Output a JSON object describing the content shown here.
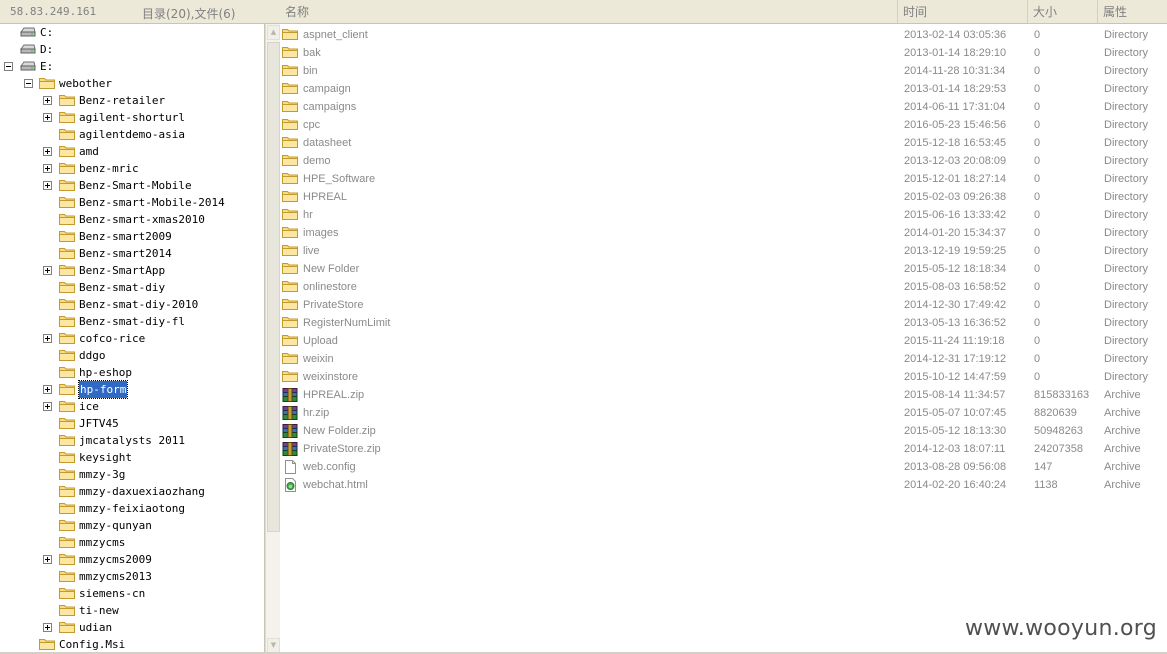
{
  "header": {
    "host_ip": "58.83.249.161",
    "dir_count": "目录(20),文件(6)"
  },
  "columns": {
    "name": "名称",
    "time": "时间",
    "size": "大小",
    "attr": "属性"
  },
  "tree": [
    {
      "label": "C:",
      "depth": 0,
      "kind": "drive",
      "expander": "none"
    },
    {
      "label": "D:",
      "depth": 0,
      "kind": "drive",
      "expander": "none"
    },
    {
      "label": "E:",
      "depth": 0,
      "kind": "drive",
      "expander": "minus"
    },
    {
      "label": "webother",
      "depth": 1,
      "kind": "folder",
      "expander": "minus"
    },
    {
      "label": "Benz-retailer",
      "depth": 2,
      "kind": "folder",
      "expander": "plus"
    },
    {
      "label": "agilent-shorturl",
      "depth": 2,
      "kind": "folder",
      "expander": "plus"
    },
    {
      "label": "agilentdemo-asia",
      "depth": 2,
      "kind": "folder",
      "expander": "none"
    },
    {
      "label": "amd",
      "depth": 2,
      "kind": "folder",
      "expander": "plus"
    },
    {
      "label": "benz-mric",
      "depth": 2,
      "kind": "folder",
      "expander": "plus"
    },
    {
      "label": "Benz-Smart-Mobile",
      "depth": 2,
      "kind": "folder",
      "expander": "plus"
    },
    {
      "label": "Benz-smart-Mobile-2014",
      "depth": 2,
      "kind": "folder",
      "expander": "none"
    },
    {
      "label": "Benz-smart-xmas2010",
      "depth": 2,
      "kind": "folder",
      "expander": "none"
    },
    {
      "label": "Benz-smart2009",
      "depth": 2,
      "kind": "folder",
      "expander": "none"
    },
    {
      "label": "Benz-smart2014",
      "depth": 2,
      "kind": "folder",
      "expander": "none"
    },
    {
      "label": "Benz-SmartApp",
      "depth": 2,
      "kind": "folder",
      "expander": "plus"
    },
    {
      "label": "Benz-smat-diy",
      "depth": 2,
      "kind": "folder",
      "expander": "none"
    },
    {
      "label": "Benz-smat-diy-2010",
      "depth": 2,
      "kind": "folder",
      "expander": "none"
    },
    {
      "label": "Benz-smat-diy-fl",
      "depth": 2,
      "kind": "folder",
      "expander": "none"
    },
    {
      "label": "cofco-rice",
      "depth": 2,
      "kind": "folder",
      "expander": "plus"
    },
    {
      "label": "ddgo",
      "depth": 2,
      "kind": "folder",
      "expander": "none"
    },
    {
      "label": "hp-eshop",
      "depth": 2,
      "kind": "folder",
      "expander": "none"
    },
    {
      "label": "hp-form",
      "depth": 2,
      "kind": "folder",
      "expander": "plus",
      "selected": true
    },
    {
      "label": "ice",
      "depth": 2,
      "kind": "folder",
      "expander": "plus"
    },
    {
      "label": "JFTV45",
      "depth": 2,
      "kind": "folder",
      "expander": "none"
    },
    {
      "label": "jmcatalysts 2011",
      "depth": 2,
      "kind": "folder",
      "expander": "none"
    },
    {
      "label": "keysight",
      "depth": 2,
      "kind": "folder",
      "expander": "none"
    },
    {
      "label": "mmzy-3g",
      "depth": 2,
      "kind": "folder",
      "expander": "none"
    },
    {
      "label": "mmzy-daxuexiaozhang",
      "depth": 2,
      "kind": "folder",
      "expander": "none"
    },
    {
      "label": "mmzy-feixiaotong",
      "depth": 2,
      "kind": "folder",
      "expander": "none"
    },
    {
      "label": "mmzy-qunyan",
      "depth": 2,
      "kind": "folder",
      "expander": "none"
    },
    {
      "label": "mmzycms",
      "depth": 2,
      "kind": "folder",
      "expander": "none"
    },
    {
      "label": "mmzycms2009",
      "depth": 2,
      "kind": "folder",
      "expander": "plus"
    },
    {
      "label": "mmzycms2013",
      "depth": 2,
      "kind": "folder",
      "expander": "none"
    },
    {
      "label": "siemens-cn",
      "depth": 2,
      "kind": "folder",
      "expander": "none"
    },
    {
      "label": "ti-new",
      "depth": 2,
      "kind": "folder",
      "expander": "none"
    },
    {
      "label": "udian",
      "depth": 2,
      "kind": "folder",
      "expander": "plus"
    },
    {
      "label": "Config.Msi",
      "depth": 1,
      "kind": "folder",
      "expander": "none"
    }
  ],
  "files": [
    {
      "name": "aspnet_client",
      "time": "2013-02-14 03:05:36",
      "size": "0",
      "attr": "Directory",
      "kind": "folder"
    },
    {
      "name": "bak",
      "time": "2013-01-14 18:29:10",
      "size": "0",
      "attr": "Directory",
      "kind": "folder"
    },
    {
      "name": "bin",
      "time": "2014-11-28 10:31:34",
      "size": "0",
      "attr": "Directory",
      "kind": "folder"
    },
    {
      "name": "campaign",
      "time": "2013-01-14 18:29:53",
      "size": "0",
      "attr": "Directory",
      "kind": "folder"
    },
    {
      "name": "campaigns",
      "time": "2014-06-11 17:31:04",
      "size": "0",
      "attr": "Directory",
      "kind": "folder"
    },
    {
      "name": "cpc",
      "time": "2016-05-23 15:46:56",
      "size": "0",
      "attr": "Directory",
      "kind": "folder"
    },
    {
      "name": "datasheet",
      "time": "2015-12-18 16:53:45",
      "size": "0",
      "attr": "Directory",
      "kind": "folder"
    },
    {
      "name": "demo",
      "time": "2013-12-03 20:08:09",
      "size": "0",
      "attr": "Directory",
      "kind": "folder"
    },
    {
      "name": "HPE_Software",
      "time": "2015-12-01 18:27:14",
      "size": "0",
      "attr": "Directory",
      "kind": "folder"
    },
    {
      "name": "HPREAL",
      "time": "2015-02-03 09:26:38",
      "size": "0",
      "attr": "Directory",
      "kind": "folder"
    },
    {
      "name": "hr",
      "time": "2015-06-16 13:33:42",
      "size": "0",
      "attr": "Directory",
      "kind": "folder"
    },
    {
      "name": "images",
      "time": "2014-01-20 15:34:37",
      "size": "0",
      "attr": "Directory",
      "kind": "folder"
    },
    {
      "name": "live",
      "time": "2013-12-19 19:59:25",
      "size": "0",
      "attr": "Directory",
      "kind": "folder"
    },
    {
      "name": "New Folder",
      "time": "2015-05-12 18:18:34",
      "size": "0",
      "attr": "Directory",
      "kind": "folder"
    },
    {
      "name": "onlinestore",
      "time": "2015-08-03 16:58:52",
      "size": "0",
      "attr": "Directory",
      "kind": "folder"
    },
    {
      "name": "PrivateStore",
      "time": "2014-12-30 17:49:42",
      "size": "0",
      "attr": "Directory",
      "kind": "folder"
    },
    {
      "name": "RegisterNumLimit",
      "time": "2013-05-13 16:36:52",
      "size": "0",
      "attr": "Directory",
      "kind": "folder"
    },
    {
      "name": "Upload",
      "time": "2015-11-24 11:19:18",
      "size": "0",
      "attr": "Directory",
      "kind": "folder"
    },
    {
      "name": "weixin",
      "time": "2014-12-31 17:19:12",
      "size": "0",
      "attr": "Directory",
      "kind": "folder"
    },
    {
      "name": "weixinstore",
      "time": "2015-10-12 14:47:59",
      "size": "0",
      "attr": "Directory",
      "kind": "folder"
    },
    {
      "name": "HPREAL.zip",
      "time": "2015-08-14 11:34:57",
      "size": "815833163",
      "attr": "Archive",
      "kind": "archive"
    },
    {
      "name": "hr.zip",
      "time": "2015-05-07 10:07:45",
      "size": "8820639",
      "attr": "Archive",
      "kind": "archive"
    },
    {
      "name": "New Folder.zip",
      "time": "2015-05-12 18:13:30",
      "size": "50948263",
      "attr": "Archive",
      "kind": "archive"
    },
    {
      "name": "PrivateStore.zip",
      "time": "2014-12-03 18:07:11",
      "size": "24207358",
      "attr": "Archive",
      "kind": "archive"
    },
    {
      "name": "web.config",
      "time": "2013-08-28 09:56:08",
      "size": "147",
      "attr": "Archive",
      "kind": "file"
    },
    {
      "name": "webchat.html",
      "time": "2014-02-20 16:40:24",
      "size": "1138",
      "attr": "Archive",
      "kind": "html"
    }
  ],
  "watermark": "www.wooyun.org",
  "colors": {
    "header_bg": "#ece9d8",
    "folder_yellow": "#f7d46b",
    "selection_blue": "#316ac5",
    "list_text": "#8a8a8a"
  }
}
